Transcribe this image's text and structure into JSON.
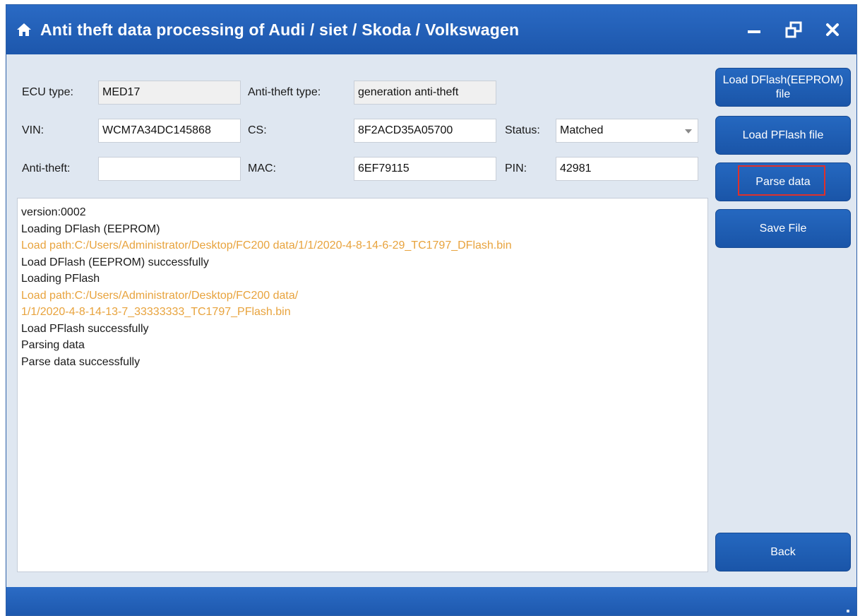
{
  "window": {
    "title": "Anti theft data processing of Audi / siet / Skoda / Volkswagen",
    "accent_color": "#1d57ac",
    "controls": {
      "minimize": "minimize-icon",
      "restore": "restore-icon",
      "close": "close-icon"
    }
  },
  "form": {
    "ecu_type": {
      "label": "ECU type:",
      "value": "MED17"
    },
    "anti_theft_type": {
      "label": "Anti-theft type:",
      "value": "generation anti-theft"
    },
    "vin": {
      "label": "VIN:",
      "value": "WCM7A34DC145868"
    },
    "cs": {
      "label": "CS:",
      "value": "8F2ACD35A05700"
    },
    "status": {
      "label": "Status:",
      "value": "Matched"
    },
    "anti_theft": {
      "label": "Anti-theft:",
      "value": ""
    },
    "mac": {
      "label": "MAC:",
      "value": "6EF79115"
    },
    "pin": {
      "label": "PIN:",
      "value": "42981"
    }
  },
  "log": {
    "lines": [
      {
        "text": "version:0002",
        "type": "info"
      },
      {
        "text": "Loading DFlash (EEPROM)",
        "type": "info"
      },
      {
        "text": "Load path:C:/Users/Administrator/Desktop/FC200 data/1/1/2020-4-8-14-6-29_TC1797_DFlash.bin",
        "type": "path"
      },
      {
        "text": "Load DFlash (EEPROM) successfully",
        "type": "info"
      },
      {
        "text": "Loading PFlash",
        "type": "info"
      },
      {
        "text": "Load path:C:/Users/Administrator/Desktop/FC200 data/",
        "type": "path"
      },
      {
        "text": "1/1/2020-4-8-14-13-7_33333333_TC1797_PFlash.bin",
        "type": "path"
      },
      {
        "text": "Load PFlash successfully",
        "type": "info"
      },
      {
        "text": "Parsing data",
        "type": "info"
      },
      {
        "text": "Parse data successfully",
        "type": "info"
      }
    ],
    "path_color": "#e8a33d"
  },
  "sidebar": {
    "load_dflash_label": "Load DFlash(EEPROM) file",
    "load_pflash_label": "Load PFlash file",
    "parse_data_label": "Parse data",
    "save_file_label": "Save File",
    "back_label": "Back"
  }
}
